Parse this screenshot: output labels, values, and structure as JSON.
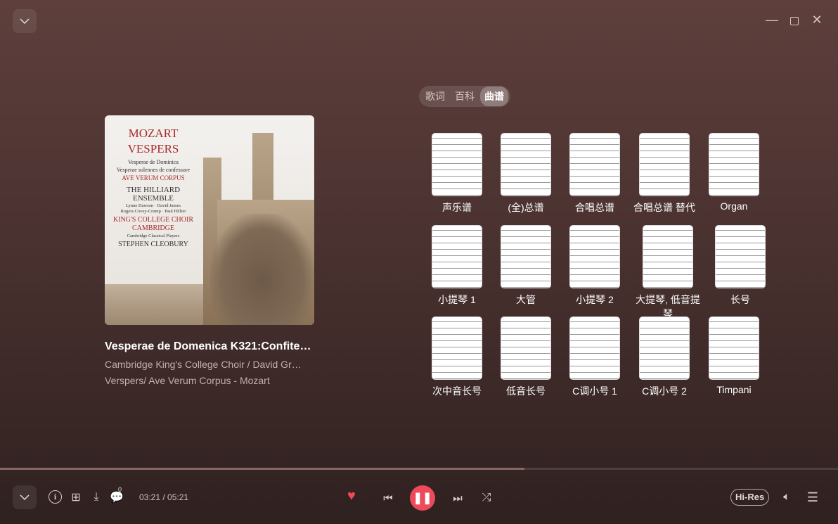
{
  "window": {
    "collapse_icon": "chevron-down-icon",
    "minimize_icon": "minimize-icon",
    "maximize_icon": "maximize-icon",
    "close_icon": "close-icon"
  },
  "tabs": [
    {
      "label": "歌词"
    },
    {
      "label": "百科"
    },
    {
      "label": "曲谱",
      "active": true
    }
  ],
  "album_cover": {
    "lines": [
      "MOZART",
      "VESPERS",
      "Vesperae de Dominica",
      "Vesperae solennes de confessore",
      "AVE VERUM CORPUS",
      "THE HILLIARD",
      "ENSEMBLE",
      "Lynne Dawson · David James",
      "Rogers Covey-Crump · Paul Hillier",
      "KING'S COLLEGE CHOIR",
      "CAMBRIDGE",
      "Cambridge Classical Players",
      "STEPHEN CLEOBURY"
    ]
  },
  "song": {
    "title": "Vesperae de Domenica K321:Confite…",
    "artists": "Cambridge King's College Choir /  David Gr…",
    "album": "Verspers/ Ave Verum Corpus - Mozart"
  },
  "scores": [
    {
      "label": "声乐谱"
    },
    {
      "label": "(全)总谱"
    },
    {
      "label": "合唱总谱"
    },
    {
      "label": "合唱总谱 替代"
    },
    {
      "label": "Organ"
    },
    {
      "label": "小提琴 1"
    },
    {
      "label": "大管"
    },
    {
      "label": "小提琴 2"
    },
    {
      "label": "大提琴, 低音提琴"
    },
    {
      "label": "长号"
    },
    {
      "label": "次中音长号"
    },
    {
      "label": "低音长号"
    },
    {
      "label": "C调小号 1"
    },
    {
      "label": "C调小号 2"
    },
    {
      "label": "Timpani"
    }
  ],
  "player": {
    "current_time": "03:21",
    "total_time": "05:21",
    "time_display": "03:21 / 05:21",
    "progress_percent": 62.6,
    "comment_count": "0",
    "quality": "Hi-Res",
    "liked": true,
    "accent": "#ee4a5a"
  }
}
